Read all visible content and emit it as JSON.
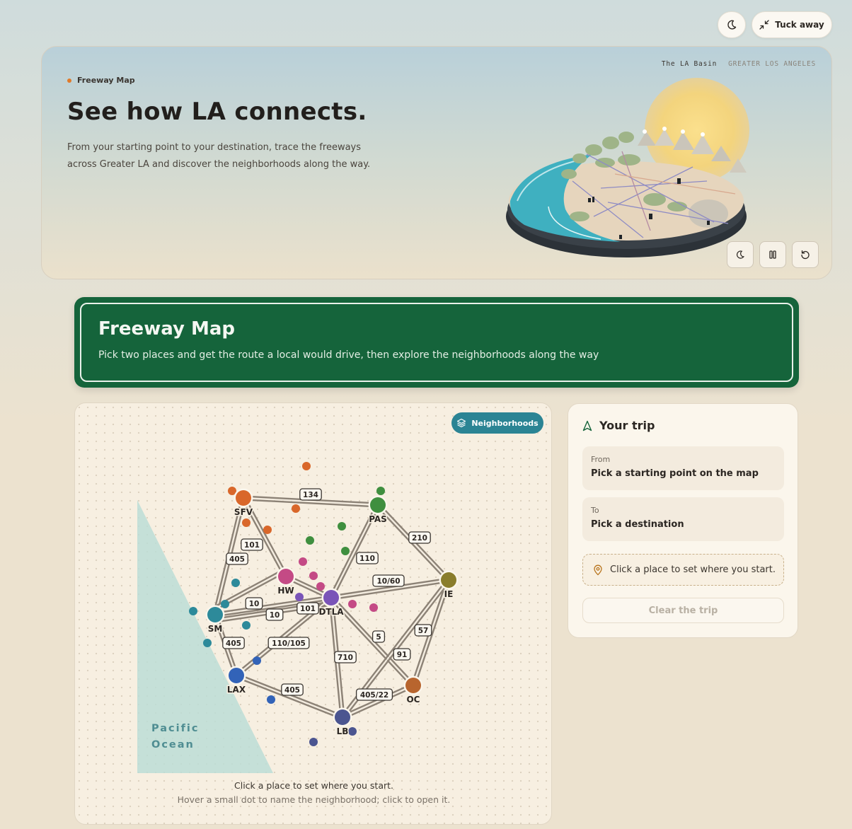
{
  "topbar": {
    "tuck_label": "Tuck away"
  },
  "hero": {
    "tag": "Freeway Map",
    "title": "See how LA connects.",
    "description": "From your starting point to your destination, trace the freeways across Greater LA and discover the neighborhoods along the way.",
    "location_primary": "The LA Basin",
    "location_secondary": "GREATER LOS ANGELES"
  },
  "banner": {
    "title": "Freeway Map",
    "subtitle": "Pick two places and get the route a local would drive, then explore the neighborhoods along the way"
  },
  "map": {
    "neighborhoods_button": "Neighborhoods",
    "ocean_line1": "Pacific",
    "ocean_line2": "Ocean",
    "hint_primary": "Click a place to set where you start.",
    "hint_secondary": "Hover a small dot to name the neighborhood; click to open it.",
    "hubs": [
      {
        "id": "SFV",
        "label": "SFV",
        "color": "#d9672a"
      },
      {
        "id": "PAS",
        "label": "PAS",
        "color": "#3f8f3f"
      },
      {
        "id": "HW",
        "label": "HW",
        "color": "#c44a85"
      },
      {
        "id": "DTLA",
        "label": "DTLA",
        "color": "#7a54b8"
      },
      {
        "id": "IE",
        "label": "IE",
        "color": "#8a7d2c"
      },
      {
        "id": "SM",
        "label": "SM",
        "color": "#2d8a9a"
      },
      {
        "id": "LAX",
        "label": "LAX",
        "color": "#3263b8"
      },
      {
        "id": "LB",
        "label": "LB",
        "color": "#4b5590"
      },
      {
        "id": "OC",
        "label": "OC",
        "color": "#b8652e"
      }
    ],
    "routes": [
      {
        "from": "SFV",
        "to": "PAS",
        "shield": "134"
      },
      {
        "from": "SFV",
        "to": "HW",
        "shield": "101"
      },
      {
        "from": "SFV",
        "to": "SM",
        "shield": "405"
      },
      {
        "from": "PAS",
        "to": "IE",
        "shield": "210"
      },
      {
        "from": "PAS",
        "to": "DTLA",
        "shield": "110"
      },
      {
        "from": "DTLA",
        "to": "IE",
        "shield": "10/60"
      },
      {
        "from": "HW",
        "to": "DTLA",
        "shield": ""
      },
      {
        "from": "SM",
        "to": "HW",
        "shield": "10"
      },
      {
        "from": "SM",
        "to": "DTLA",
        "shield": "10"
      },
      {
        "from": "SM",
        "to": "DTLA",
        "shield": "101"
      },
      {
        "from": "SM",
        "to": "LAX",
        "shield": "405"
      },
      {
        "from": "LAX",
        "to": "DTLA",
        "shield": "110/105"
      },
      {
        "from": "LAX",
        "to": "LB",
        "shield": "405"
      },
      {
        "from": "DTLA",
        "to": "LB",
        "shield": "710"
      },
      {
        "from": "DTLA",
        "to": "OC",
        "shield": "5"
      },
      {
        "from": "IE",
        "to": "OC",
        "shield": "57"
      },
      {
        "from": "IE",
        "to": "LB",
        "shield": "91"
      },
      {
        "from": "LB",
        "to": "OC",
        "shield": "405/22"
      }
    ]
  },
  "trip": {
    "title": "Your trip",
    "from_label": "From",
    "from_value": "Pick a starting point on the map",
    "to_label": "To",
    "to_value": "Pick a destination",
    "hint": "Click a place to set where you start.",
    "clear_label": "Clear the trip"
  }
}
